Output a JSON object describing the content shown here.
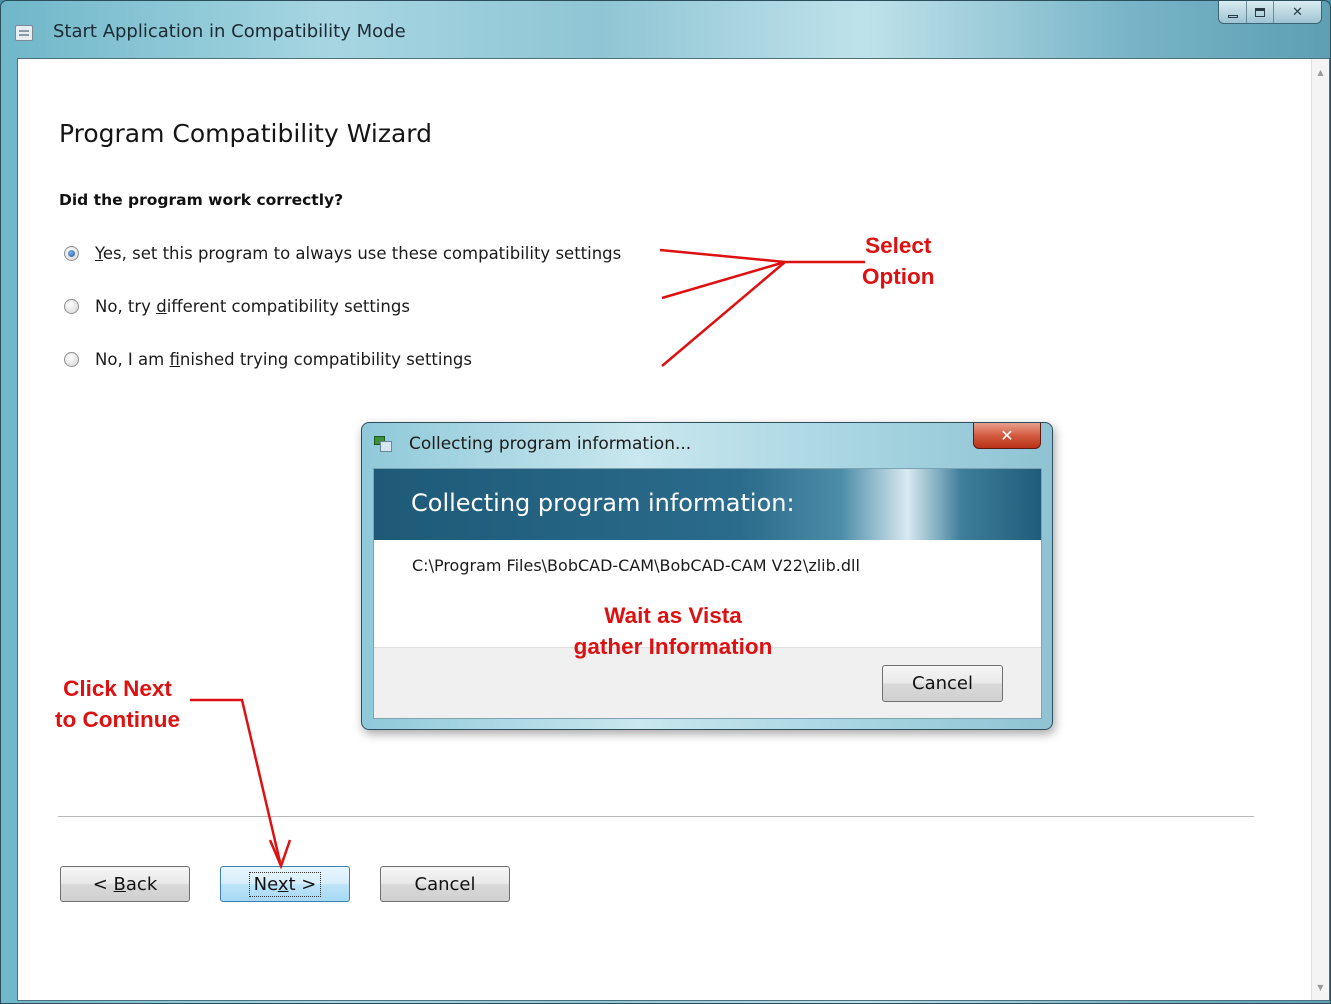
{
  "window": {
    "title": "Start Application in Compatibility Mode",
    "controls": {
      "minimize": "minimize",
      "maximize": "maximize",
      "close": "✕"
    }
  },
  "wizard": {
    "heading": "Program Compatibility Wizard",
    "question": "Did the program work correctly?",
    "options": [
      {
        "label_pre": "",
        "mnemonic": "Y",
        "label_post": "es, set this program to always use these compatibility settings",
        "checked": true
      },
      {
        "label_pre": "No, try ",
        "mnemonic": "d",
        "label_post": "ifferent compatibility settings",
        "checked": false
      },
      {
        "label_pre": "No, I am ",
        "mnemonic": "f",
        "label_post": "inished trying compatibility settings",
        "checked": false
      }
    ],
    "buttons": {
      "back": {
        "pre": "< ",
        "mnemonic": "B",
        "post": "ack"
      },
      "next": {
        "pre": "Ne",
        "mnemonic": "x",
        "post": "t >"
      },
      "cancel": "Cancel"
    }
  },
  "dialog": {
    "title": "Collecting program information...",
    "close": "✕",
    "banner": "Collecting program information:",
    "path": "C:\\Program Files\\BobCAD-CAM\\BobCAD-CAM V22\\zlib.dll",
    "cancel": "Cancel"
  },
  "annotations": {
    "select_option": [
      "Select",
      "Option"
    ],
    "wait": [
      "Wait as Vista",
      "gather Information"
    ],
    "click_next": [
      "Click Next",
      "to Continue"
    ],
    "color": "#dd1111"
  }
}
